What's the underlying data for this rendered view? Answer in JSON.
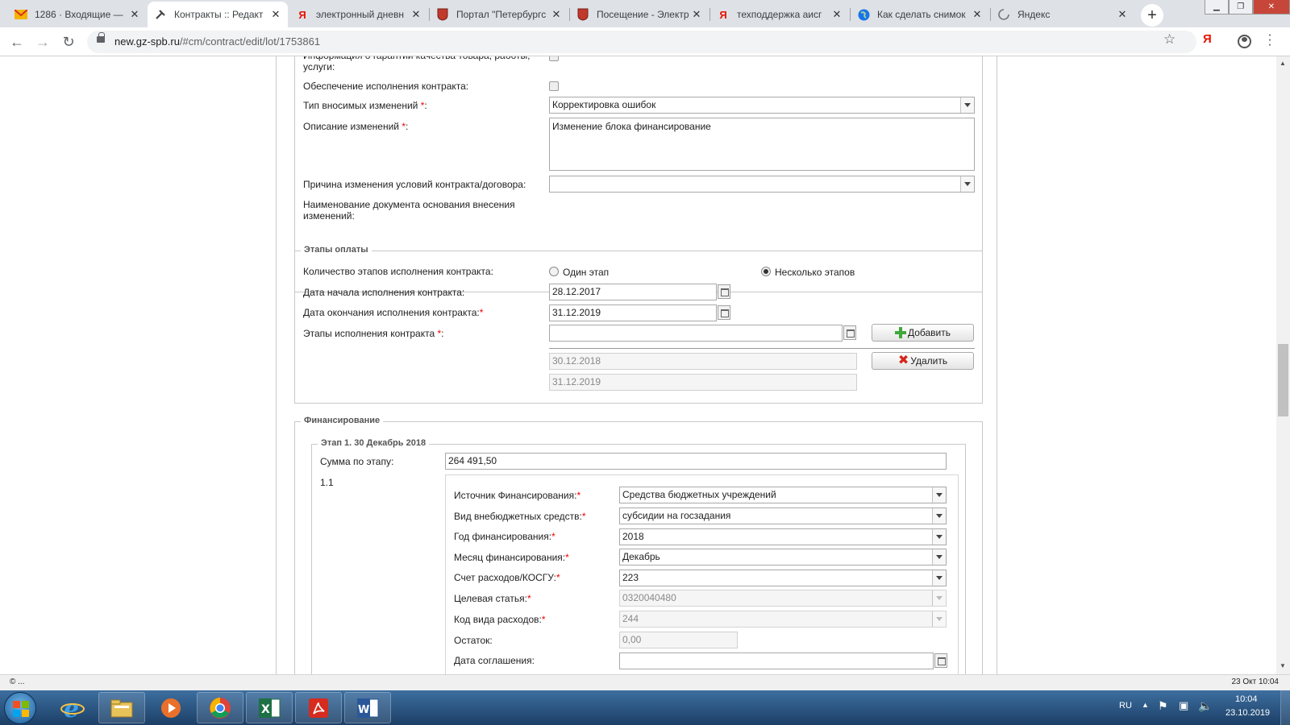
{
  "browser": {
    "tabs": [
      {
        "title": "1286 · Входящие — ",
        "icon": "mail-icon"
      },
      {
        "title": "Контракты :: Редакт",
        "icon": "contract-icon"
      },
      {
        "title": "электронный дневн",
        "icon": "yandex-icon"
      },
      {
        "title": "Портал \"Петербургс",
        "icon": "crest-icon"
      },
      {
        "title": "Посещение - Электр",
        "icon": "crest-icon"
      },
      {
        "title": "техподдержка аисг",
        "icon": "yandex-icon"
      },
      {
        "title": "Как сделать снимок",
        "icon": "globe-icon"
      },
      {
        "title": "Яндекс",
        "icon": "loading-icon"
      }
    ],
    "url_host": "new.gz-spb.ru",
    "url_path": "/#cm/contract/edit/lot/1753861"
  },
  "form": {
    "warranty_label": "Информация о гарантии качества товара, работы, услуги:",
    "security_label": "Обеспечение исполнения контракта:",
    "change_type_label": "Тип вносимых изменений ",
    "change_type_value": "Корректировка ошибок",
    "description_label": "Описание изменений ",
    "description_value": "Изменение блока финансирование",
    "reason_label": "Причина изменения условий контракта/договора:",
    "docname_label": "Наименование документа основания внесения изменений:",
    "req_mark": "*",
    "colon": ":"
  },
  "payment_stages": {
    "legend": "Этапы оплаты",
    "count_label": "Количество этапов исполнения контракта:",
    "radio_one": "Один этап",
    "radio_many": "Несколько этапов",
    "start_label": "Дата начала исполнения контракта:",
    "start_value": "28.12.2017",
    "end_label": "Дата окончания исполнения контракта:",
    "end_value": "31.12.2019",
    "stages_label": "Этапы исполнения контракта ",
    "add_button": "Добавить",
    "delete_button": "Удалить",
    "stage_dates": [
      "30.12.2018",
      "31.12.2019"
    ]
  },
  "financing": {
    "legend": "Финансирование",
    "stage_legend": "Этап 1. 30 Декабрь 2018",
    "sum_label": "Сумма по этапу:",
    "sum_value": "264 491,50",
    "row_number": "1.1",
    "source_label": "Источник Финансирования:",
    "source_value": "Средства бюджетных учреждений",
    "offbudget_label": "Вид внебюджетных средств:",
    "offbudget_value": "субсидии на госзадания",
    "year_label": "Год финансирования:",
    "year_value": "2018",
    "month_label": "Месяц финансирования:",
    "month_value": "Декабрь",
    "account_label": "Счет расходов/КОСГУ:",
    "account_value": "223",
    "target_label": "Целевая статья:",
    "target_value": "0320040480",
    "expense_code_label": "Код вида расходов:",
    "expense_code_value": "244",
    "balance_label": "Остаток:",
    "balance_value": "0,00",
    "agreement_label": "Дата соглашения:"
  },
  "status": {
    "left": "© ...",
    "right": "23 Окт 10:04"
  },
  "taskbar": {
    "lang": "RU",
    "time": "10:04",
    "date": "23.10.2019"
  }
}
